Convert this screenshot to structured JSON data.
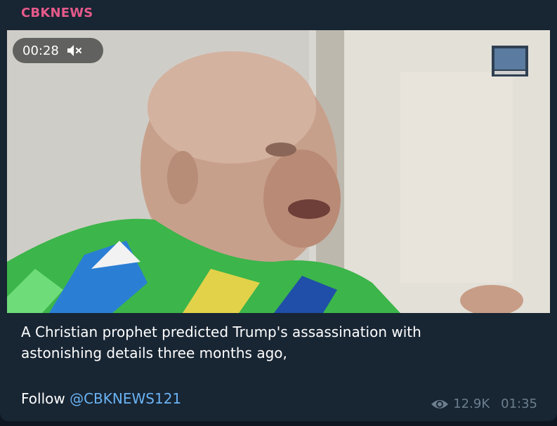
{
  "post": {
    "channel": "CBKNEWS",
    "caption_line1": "A Christian prophet predicted Trump's assassination with",
    "caption_line2": "astonishing details three months ago,",
    "follow_text": "Follow ",
    "follow_handle": "@CBKNEWS121",
    "views": "12.9K",
    "time": "01:35"
  },
  "video": {
    "duration": "00:28",
    "muted": true
  },
  "icons": {
    "mute": "speaker-muted-icon",
    "views": "eye-icon"
  },
  "colors": {
    "channel": "#e55a8a",
    "link": "#6ab3f3",
    "bubble": "#182533",
    "meta": "#6d7f8f"
  }
}
